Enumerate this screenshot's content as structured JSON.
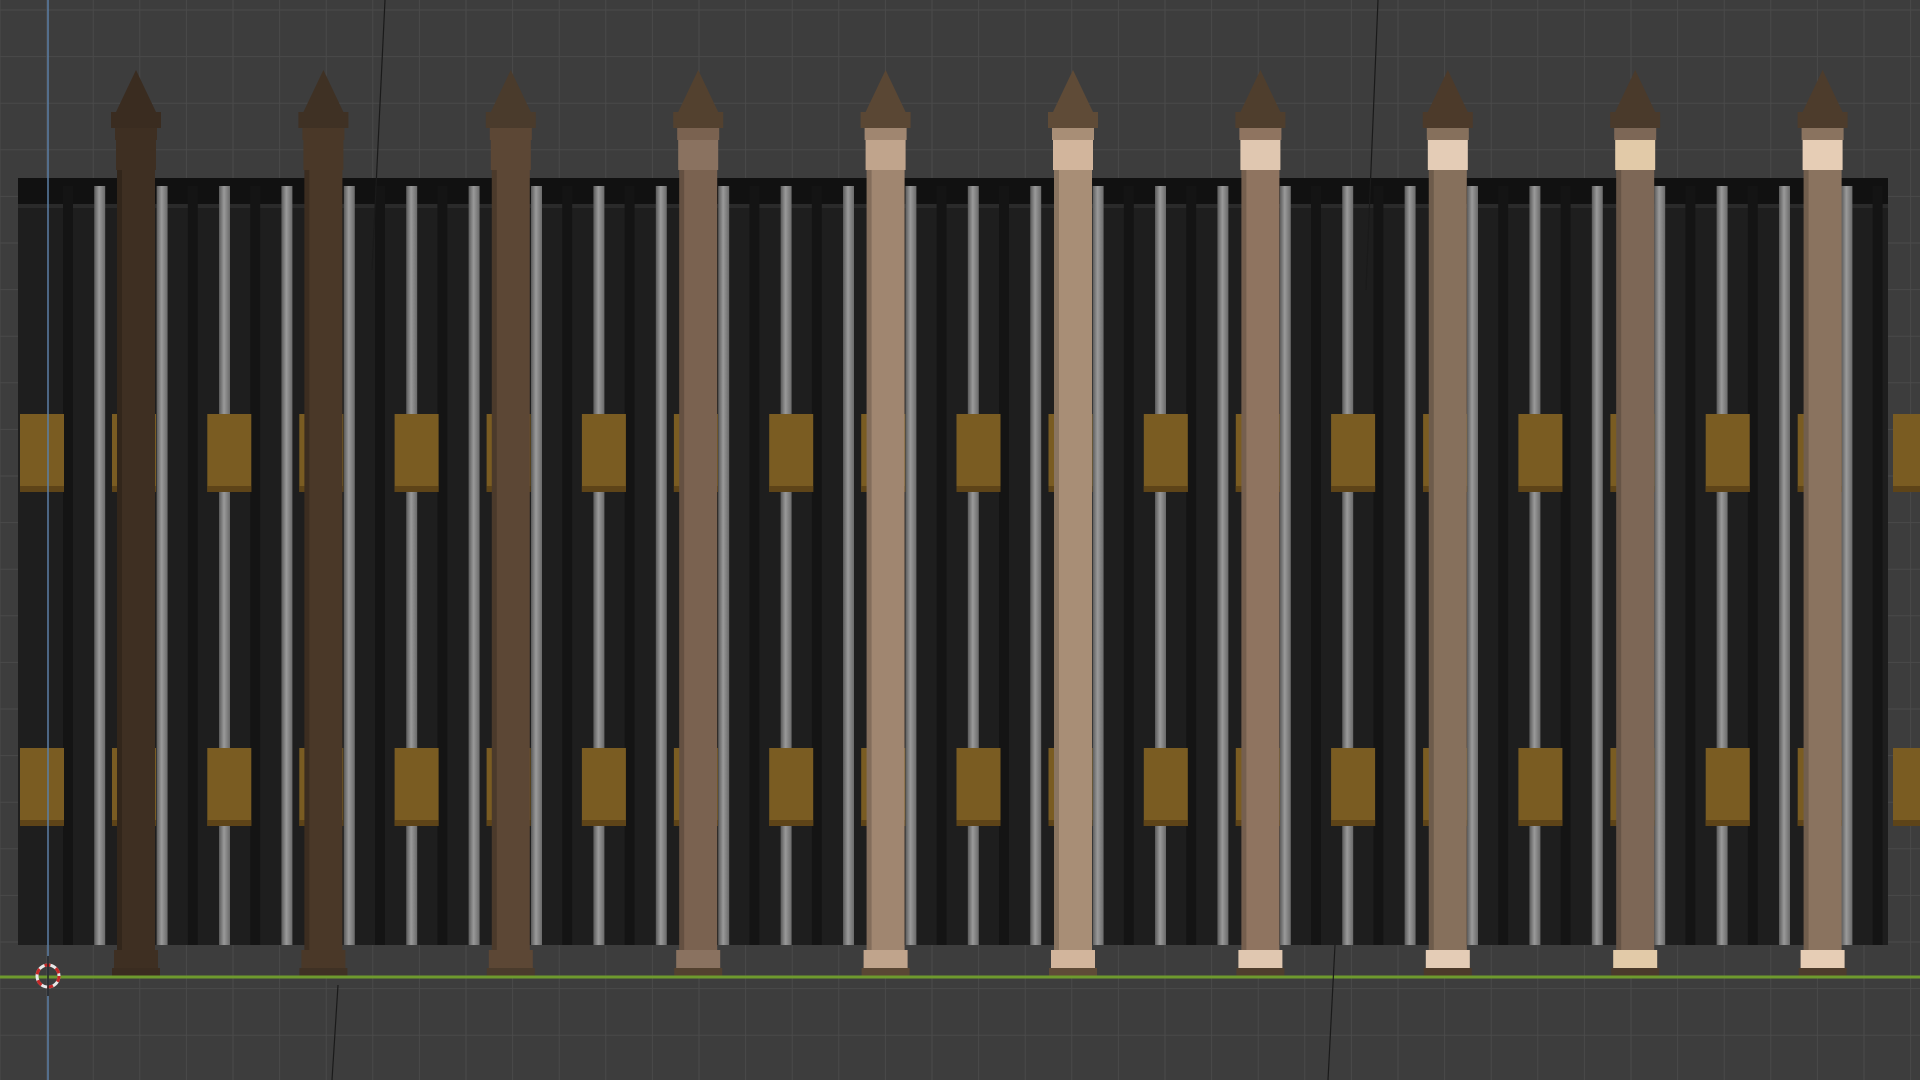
{
  "viewport": {
    "mode": "orthographic-front",
    "background": "#3d3d3d",
    "grid_color": "#4a4a4a",
    "ground_axis_color": "#6e9a2e",
    "vertical_axis_color": "#5b7fa6"
  },
  "fence": {
    "panel_color": "#1e1e1e",
    "panel_dark_color": "#141414",
    "bar_color": "#8a8a8a",
    "bar_shadow_color": "#5a5a5a",
    "rail_color": "#111111",
    "plank_color": "#7a5c22",
    "plank_dark_color": "#5e4418",
    "post_count": 10,
    "post_colors": [
      "#3e2f22",
      "#4a3828",
      "#5c4735",
      "#7a6250",
      "#a08670",
      "#a88e76",
      "#8f7460",
      "#86705c",
      "#7d6756",
      "#8a735f"
    ],
    "post_cap_colors": [
      "#3a2c20",
      "#3f3124",
      "#4a3b2c",
      "#53412f",
      "#5a4734",
      "#5f4b37",
      "#4f3e2d",
      "#4c3a2a",
      "#4a3a2b",
      "#4d3c2c"
    ],
    "post_collar_colors": [
      "#3e2f22",
      "#4a3828",
      "#5c4735",
      "#8a7260",
      "#c0a48c",
      "#d2b59c",
      "#e0c7b0",
      "#e4ccb6",
      "#e2caa8",
      "#e6cdb5"
    ]
  },
  "cursor_3d": {
    "icon": "3d-cursor-icon",
    "ring_color": "#e8e8e8",
    "accent_color": "#c62828"
  }
}
